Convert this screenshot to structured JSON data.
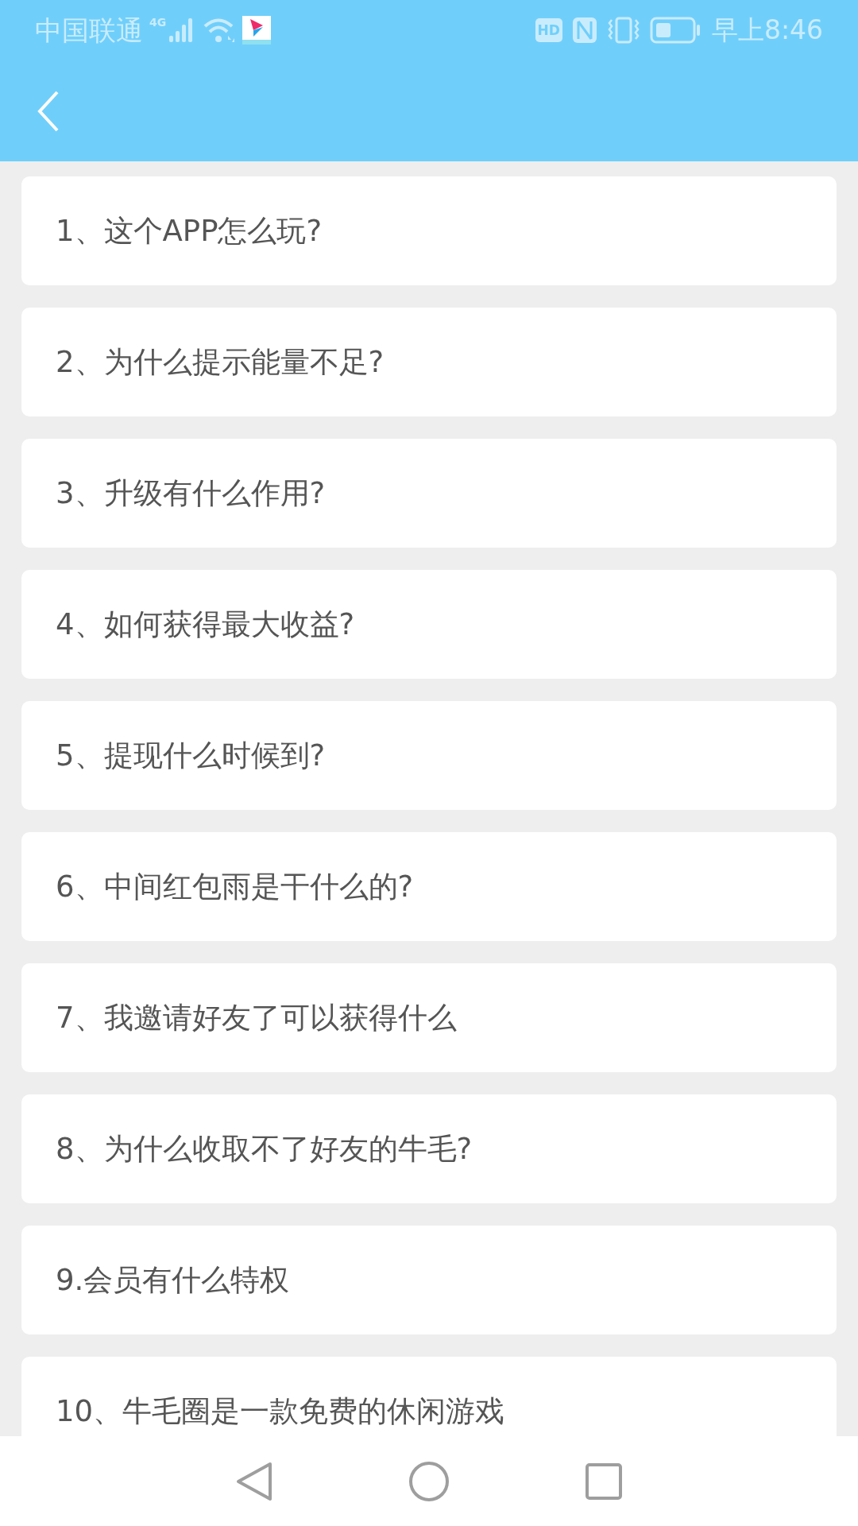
{
  "status_bar": {
    "carrier": "中国联通",
    "network": "4G",
    "hd": "HD",
    "time": "早上8:46"
  },
  "faq": [
    {
      "question": "1、这个APP怎么玩?"
    },
    {
      "question": "2、为什么提示能量不足?"
    },
    {
      "question": "3、升级有什么作用?"
    },
    {
      "question": "4、如何获得最大收益?"
    },
    {
      "question": "5、提现什么时候到?"
    },
    {
      "question": "6、中间红包雨是干什么的?"
    },
    {
      "question": "7、我邀请好友了可以获得什么"
    },
    {
      "question": "8、为什么收取不了好友的牛毛?"
    },
    {
      "question": "9.会员有什么特权"
    },
    {
      "question": "10、牛毛圈是一款免费的休闲游戏"
    }
  ]
}
